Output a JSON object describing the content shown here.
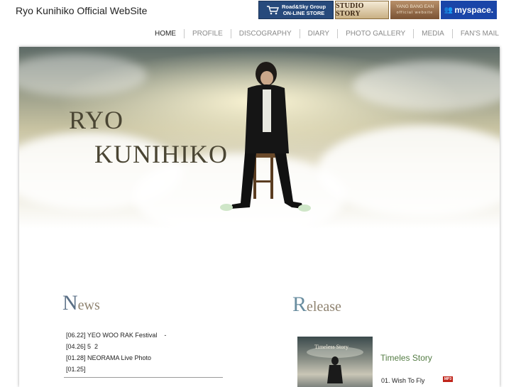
{
  "site": {
    "title": "Ryo Kunihiko Official WebSite"
  },
  "banners": {
    "store": {
      "line1": "Road&Sky Group",
      "line2": "ON-LINE STORE",
      "icon": "cart-icon"
    },
    "studio": {
      "label": "STUDIO STORY"
    },
    "yang": {
      "line1": "YANG BANG EAN",
      "line2": "official website"
    },
    "myspace": {
      "label": "myspace."
    }
  },
  "nav": {
    "items": [
      {
        "label": "HOME",
        "active": true
      },
      {
        "label": "PROFILE"
      },
      {
        "label": "DISCOGRAPHY"
      },
      {
        "label": "DIARY"
      },
      {
        "label": "PHOTO GALLERY"
      },
      {
        "label": "MEDIA"
      },
      {
        "label": "FAN'S MAIL"
      }
    ]
  },
  "hero": {
    "name_line1": "RYO",
    "name_line2": "KUNIHIKO"
  },
  "news": {
    "title_cap": "N",
    "title_rest": "ews",
    "items": [
      "[06.22] YEO WOO RAK Festival    -",
      "[04.26] 5  2",
      "[01.28] NEORAMA Live Photo",
      "[01.25]"
    ]
  },
  "release": {
    "title_cap": "R",
    "title_rest": "elease",
    "album_cover_text": "Timeless Story",
    "album_title": "Timeles Story",
    "track": "01. Wish To Fly",
    "track_badge": "MP3"
  },
  "colors": {
    "nav_active": "#222222",
    "nav_inactive": "#8a8a8a",
    "album_title": "#557d45"
  }
}
